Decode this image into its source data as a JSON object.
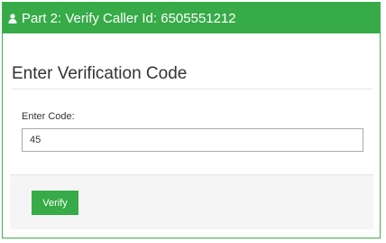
{
  "header": {
    "icon": "user-icon",
    "title": "Part 2: Verify Caller Id: 6505551212"
  },
  "section": {
    "title": "Enter Verification Code"
  },
  "form": {
    "code_label": "Enter Code:",
    "code_value": "45"
  },
  "footer": {
    "verify_label": "Verify"
  },
  "colors": {
    "accent": "#36ab47",
    "footer_bg": "#f5f5f5"
  }
}
